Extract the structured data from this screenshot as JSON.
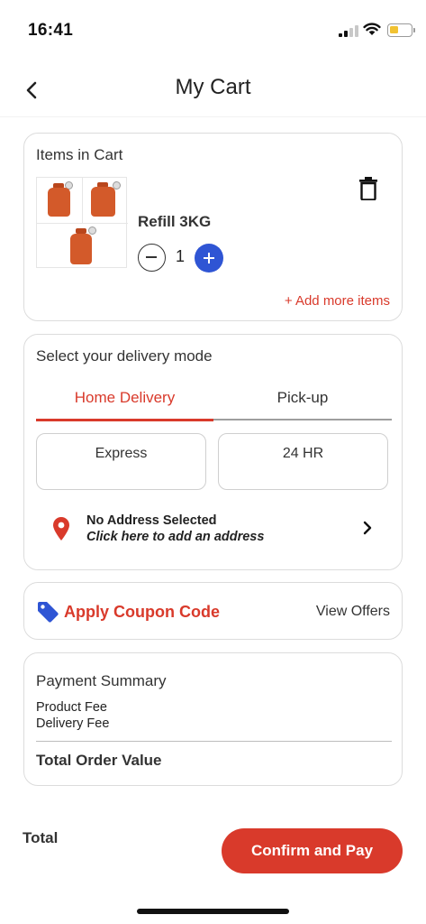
{
  "status_bar": {
    "time": "16:41"
  },
  "header": {
    "title": "My Cart"
  },
  "cart": {
    "section_label": "Items in Cart",
    "item": {
      "name": "Refill 3KG",
      "quantity": "1"
    },
    "add_more_label": "+ Add more items"
  },
  "delivery": {
    "section_label": "Select your delivery mode",
    "tabs": [
      {
        "label": "Home Delivery",
        "selected": true
      },
      {
        "label": "Pick-up",
        "selected": false
      }
    ],
    "modes": [
      {
        "label": "Express"
      },
      {
        "label": "24 HR"
      }
    ],
    "address": {
      "title": "No Address Selected",
      "subtitle": "Click here to add an address"
    }
  },
  "coupon": {
    "label": "Apply Coupon Code",
    "view_offers": "View Offers"
  },
  "payment": {
    "title": "Payment Summary",
    "rows": [
      {
        "label": "Product Fee"
      },
      {
        "label": "Delivery Fee"
      }
    ],
    "total_label": "Total Order Value"
  },
  "footer": {
    "total_label": "Total",
    "confirm_label": "Confirm and Pay"
  },
  "colors": {
    "accent_red": "#d93a2b",
    "accent_blue": "#2f55d4"
  },
  "icons": [
    "back-arrow-icon",
    "trash-icon",
    "minus-icon",
    "plus-icon",
    "location-pin-icon",
    "chevron-right-icon",
    "tag-icon"
  ]
}
